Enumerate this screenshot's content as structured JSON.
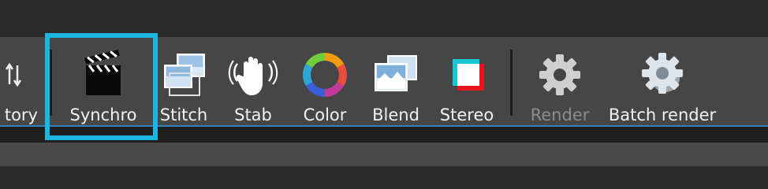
{
  "toolbar": {
    "items": [
      {
        "id": "history",
        "label": "tory",
        "icon": "history-sort-icon",
        "enabled": true
      },
      {
        "id": "synchro",
        "label": "Synchro",
        "icon": "clapperboard-icon",
        "enabled": true,
        "highlighted": true
      },
      {
        "id": "stitch",
        "label": "Stitch",
        "icon": "stitch-photos-icon",
        "enabled": true
      },
      {
        "id": "stab",
        "label": "Stab",
        "icon": "hand-stabilize-icon",
        "enabled": true
      },
      {
        "id": "color",
        "label": "Color",
        "icon": "color-wheel-icon",
        "enabled": true
      },
      {
        "id": "blend",
        "label": "Blend",
        "icon": "blend-photos-icon",
        "enabled": true
      },
      {
        "id": "stereo",
        "label": "Stereo",
        "icon": "stereo-icon",
        "enabled": true
      },
      {
        "id": "render",
        "label": "Render",
        "icon": "gear-icon",
        "enabled": false
      },
      {
        "id": "batch_render",
        "label": "Batch render",
        "icon": "batch-gear-icon",
        "enabled": true
      }
    ]
  },
  "colors": {
    "toolbar_bg": "#464646",
    "highlight_border": "#1cb5e0",
    "accent_line": "#2f82c5",
    "label_enabled": "#f2f2f2",
    "label_disabled": "#8c8c8c"
  }
}
